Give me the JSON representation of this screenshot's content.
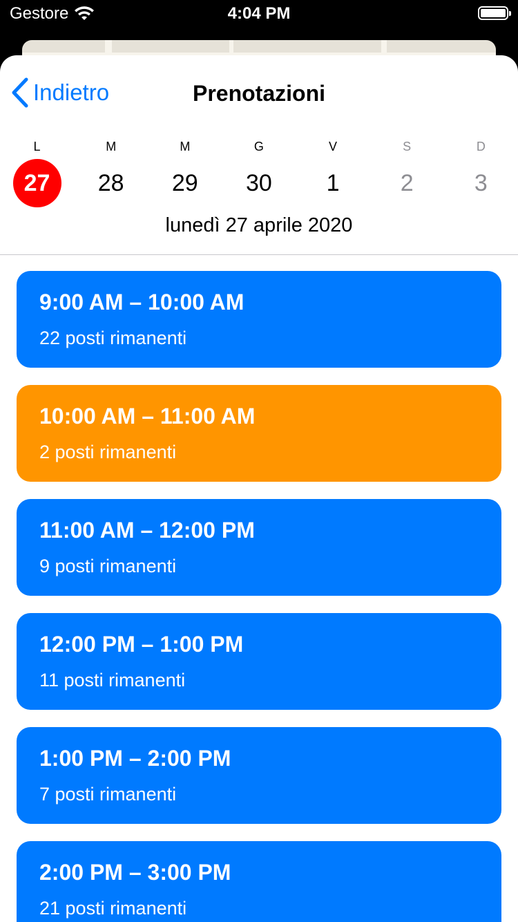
{
  "status_bar": {
    "carrier": "Gestore",
    "time": "4:04 PM"
  },
  "nav": {
    "back_label": "Indietro",
    "title": "Prenotazioni"
  },
  "week": {
    "days": [
      {
        "letter": "L",
        "number": "27",
        "selected": true,
        "weekend": false
      },
      {
        "letter": "M",
        "number": "28",
        "selected": false,
        "weekend": false
      },
      {
        "letter": "M",
        "number": "29",
        "selected": false,
        "weekend": false
      },
      {
        "letter": "G",
        "number": "30",
        "selected": false,
        "weekend": false
      },
      {
        "letter": "V",
        "number": "1",
        "selected": false,
        "weekend": false
      },
      {
        "letter": "S",
        "number": "2",
        "selected": false,
        "weekend": true
      },
      {
        "letter": "D",
        "number": "3",
        "selected": false,
        "weekend": true
      }
    ],
    "selected_date_label": "lunedì 27 aprile 2020"
  },
  "colors": {
    "available": "#007aff",
    "limited": "#ff9500",
    "selected_day": "#ff0000"
  },
  "slots": [
    {
      "time": "9:00 AM – 10:00 AM",
      "seats": "22 posti rimanenti",
      "status": "available"
    },
    {
      "time": "10:00 AM – 11:00 AM",
      "seats": "2 posti rimanenti",
      "status": "limited"
    },
    {
      "time": "11:00 AM – 12:00 PM",
      "seats": "9 posti rimanenti",
      "status": "available"
    },
    {
      "time": "12:00 PM – 1:00 PM",
      "seats": "11 posti rimanenti",
      "status": "available"
    },
    {
      "time": "1:00 PM – 2:00 PM",
      "seats": "7 posti rimanenti",
      "status": "available"
    },
    {
      "time": "2:00 PM – 3:00 PM",
      "seats": "21 posti rimanenti",
      "status": "available"
    }
  ]
}
